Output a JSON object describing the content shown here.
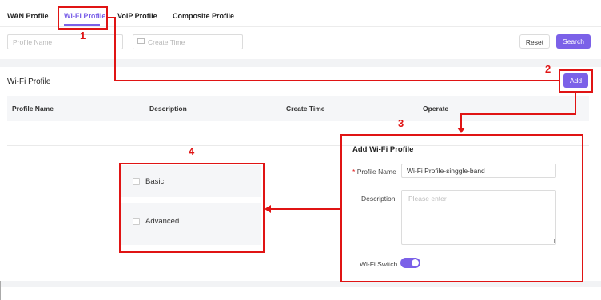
{
  "tabs": [
    "WAN Profile",
    "Wi-Fi Profile",
    "VoIP Profile",
    "Composite Profile"
  ],
  "filters": {
    "profile_name_placeholder": "Profile Name",
    "create_time_placeholder": "Create Time",
    "reset": "Reset",
    "search": "Search"
  },
  "section": {
    "title": "Wi-Fi Profile",
    "add": "Add"
  },
  "table": {
    "columns": [
      "Profile Name",
      "Description",
      "Create Time",
      "Operate"
    ]
  },
  "dialog": {
    "title": "Add Wi-Fi Profile",
    "required_mark": "*",
    "profile_name_label": "Profile Name",
    "profile_name_value": "Wi-Fi Profile-singgle-band",
    "description_label": "Description",
    "description_placeholder": "Please enter",
    "wifi_switch_label": "Wi-Fi Switch",
    "wifi_switch_on": true
  },
  "options": [
    "Basic",
    "Advanced"
  ],
  "callouts": [
    "1",
    "2",
    "3",
    "4"
  ],
  "colors": {
    "accent": "#7b61e8",
    "annotation": "#e01414"
  }
}
